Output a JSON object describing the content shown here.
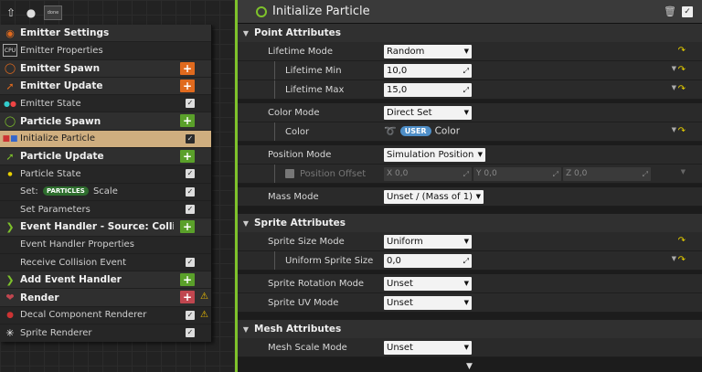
{
  "toolbar": {
    "thumb_label": "done"
  },
  "stack": {
    "rows": [
      {
        "label": "Emitter Settings"
      },
      {
        "label": "Emitter Properties"
      },
      {
        "label": "Emitter Spawn"
      },
      {
        "label": "Emitter Update"
      },
      {
        "label": "Emitter State"
      },
      {
        "label": "Particle Spawn"
      },
      {
        "label": "Initialize Particle"
      },
      {
        "label": "Particle Update"
      },
      {
        "label": "Particle State"
      },
      {
        "label_pre": "Set:",
        "pill": "PARTICLES",
        "label_post": "Scale"
      },
      {
        "label": "Set Parameters"
      },
      {
        "label": "Event Handler - Source: CollisionEvent"
      },
      {
        "label": "Event Handler Properties"
      },
      {
        "label": "Receive Collision Event"
      },
      {
        "label": "Add Event Handler"
      },
      {
        "label": "Render"
      },
      {
        "label": "Decal Component Renderer"
      },
      {
        "label": "Sprite Renderer"
      }
    ]
  },
  "panel": {
    "title": "Initialize Particle",
    "sections": {
      "point": "Point Attributes",
      "sprite": "Sprite Attributes",
      "mesh": "Mesh Attributes"
    },
    "props": {
      "lifetime_mode": {
        "label": "Lifetime Mode",
        "value": "Random"
      },
      "lifetime_min": {
        "label": "Lifetime Min",
        "value": "10,0"
      },
      "lifetime_max": {
        "label": "Lifetime Max",
        "value": "15,0"
      },
      "color_mode": {
        "label": "Color Mode",
        "value": "Direct Set"
      },
      "color": {
        "label": "Color",
        "pill": "USER",
        "value": "Color"
      },
      "position_mode": {
        "label": "Position Mode",
        "value": "Simulation Position"
      },
      "position_offset": {
        "label": "Position Offset",
        "x": "X 0,0",
        "y": "Y 0,0",
        "z": "Z 0,0"
      },
      "mass_mode": {
        "label": "Mass Mode",
        "value": "Unset / (Mass of 1)"
      },
      "sprite_size_mode": {
        "label": "Sprite Size Mode",
        "value": "Uniform"
      },
      "uniform_sprite_size": {
        "label": "Uniform Sprite Size",
        "value": "0,0"
      },
      "sprite_rotation_mode": {
        "label": "Sprite Rotation Mode",
        "value": "Unset"
      },
      "sprite_uv_mode": {
        "label": "Sprite UV Mode",
        "value": "Unset"
      },
      "mesh_scale_mode": {
        "label": "Mesh Scale Mode",
        "value": "Unset"
      }
    }
  },
  "colors": {
    "accent_green": "#7ec22b",
    "selected_row": "#cfae7f",
    "spawn_orange": "#e06a1e",
    "render_red": "#c0464f",
    "user_pill": "#4e8ec7",
    "reset_yellow": "#e8d000"
  }
}
